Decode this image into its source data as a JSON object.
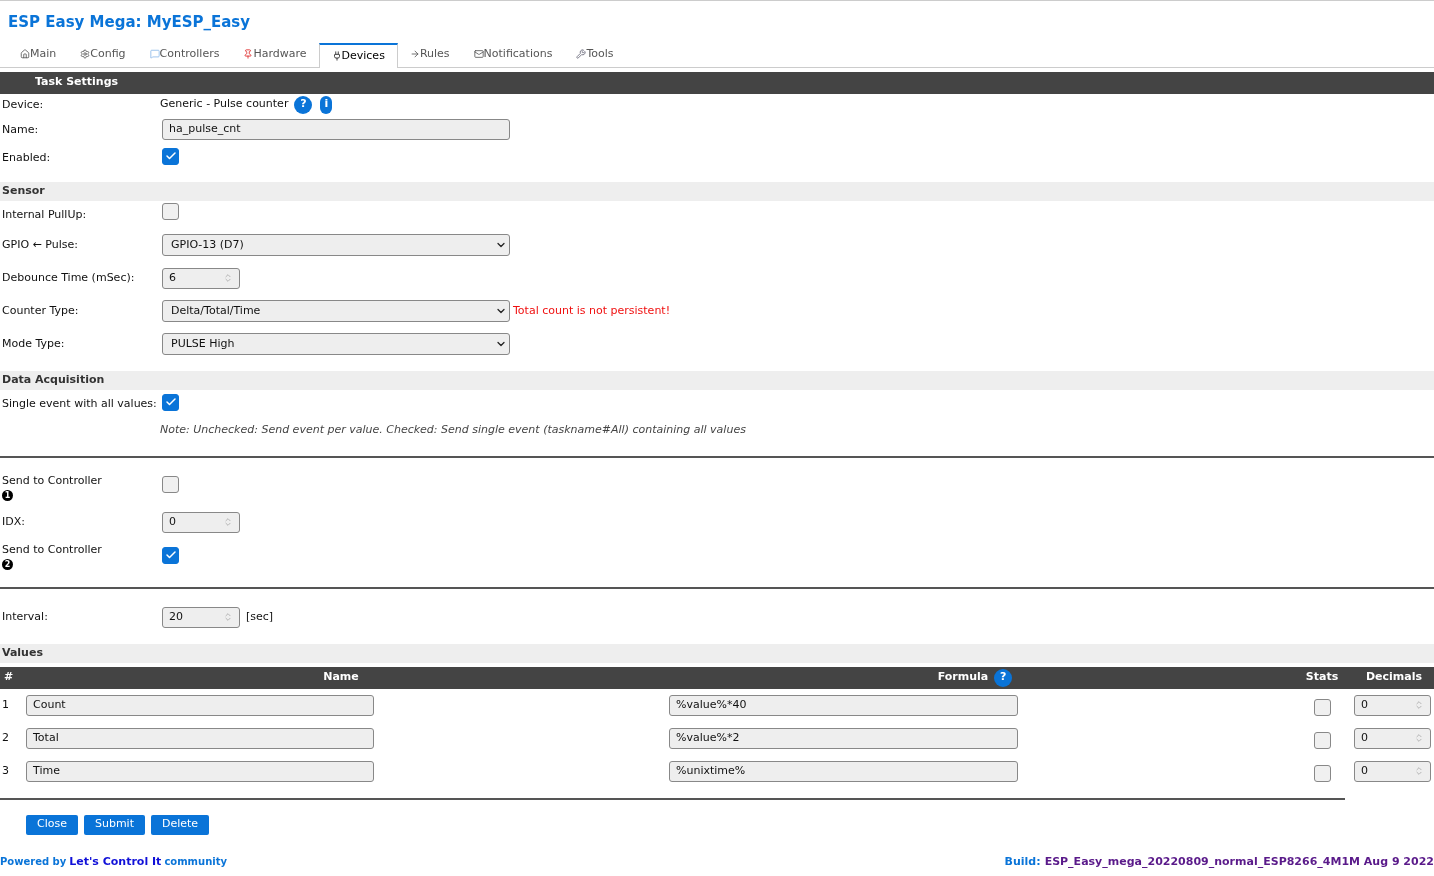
{
  "title": "ESP Easy Mega: MyESP_Easy",
  "tabs": [
    {
      "label": "Main",
      "selected": false
    },
    {
      "label": "Config",
      "selected": false
    },
    {
      "label": "Controllers",
      "selected": false
    },
    {
      "label": "Hardware",
      "selected": false
    },
    {
      "label": "Devices",
      "selected": true
    },
    {
      "label": "Rules",
      "selected": false
    },
    {
      "label": "Notifications",
      "selected": false
    },
    {
      "label": "Tools",
      "selected": false
    }
  ],
  "heading": "Task Settings",
  "rows": [
    {
      "kind": "device",
      "label": "Device:",
      "value": "Generic - Pulse counter",
      "help": "?",
      "info": "i"
    },
    {
      "kind": "text",
      "label": "Name:",
      "value": "ha_pulse_cnt"
    },
    {
      "kind": "checkbox",
      "label": "Enabled:",
      "checked": true
    },
    {
      "kind": "section",
      "label": "Sensor"
    },
    {
      "kind": "checkbox",
      "label": "Internal PullUp:",
      "checked": false
    },
    {
      "kind": "select",
      "label": "GPIO ← Pulse:",
      "value": "GPIO-13 (D7)"
    },
    {
      "kind": "number",
      "label": "Debounce Time (mSec):",
      "value": "6"
    },
    {
      "kind": "select",
      "label": "Counter Type:",
      "value": "Delta/Total/Time",
      "warning": "Total count is not persistent!"
    },
    {
      "kind": "select",
      "label": "Mode Type:",
      "value": "PULSE High"
    },
    {
      "kind": "section",
      "label": "Data Acquisition"
    },
    {
      "kind": "checkbox",
      "label": "Single event with all values:",
      "checked": true
    },
    {
      "kind": "note",
      "label": "Note: Unchecked: Send event per value. Checked: Send single event (taskname#All) containing all values"
    },
    {
      "kind": "separator"
    },
    {
      "kind": "checkbox",
      "label": "Send to Controller",
      "badge": "1",
      "checked": false
    },
    {
      "kind": "number",
      "label": "IDX:",
      "value": "0"
    },
    {
      "kind": "checkbox",
      "label": "Send to Controller",
      "badge": "2",
      "checked": true
    },
    {
      "kind": "separator"
    },
    {
      "kind": "number",
      "label": "Interval:",
      "value": "20",
      "unit": "[sec]"
    },
    {
      "kind": "section",
      "label": "Values"
    }
  ],
  "values_table": {
    "columns": [
      "#",
      "Name",
      "Formula",
      "Stats",
      "Decimals"
    ],
    "formula_help": "?",
    "rows": [
      {
        "index": "1",
        "name": "Count",
        "formula": "%value%*40",
        "stats": false,
        "decimals": "0"
      },
      {
        "index": "2",
        "name": "Total",
        "formula": "%value%*2",
        "stats": false,
        "decimals": "0"
      },
      {
        "index": "3",
        "name": "Time",
        "formula": "%unixtime%",
        "stats": false,
        "decimals": "0"
      }
    ]
  },
  "buttons": [
    "Close",
    "Submit",
    "Delete"
  ],
  "footer": {
    "powered_prefix": "Powered by",
    "link": "Let's Control It",
    "suffix": "community",
    "build_label": "Build:",
    "build": "ESP_Easy_mega_20220809_normal_ESP8266_4M1M Aug 9 2022"
  }
}
